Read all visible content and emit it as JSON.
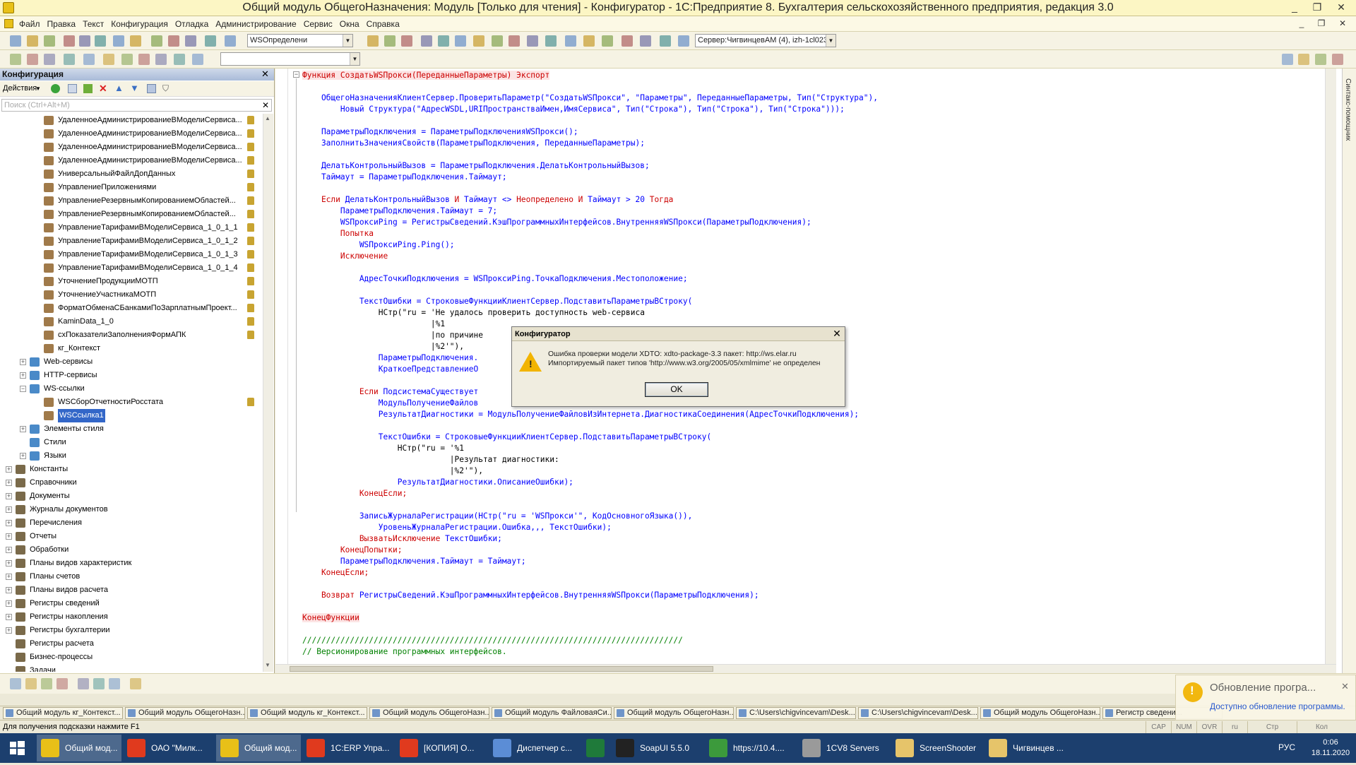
{
  "window": {
    "title": "Общий модуль ОбщегоНазначения: Модуль [Только для чтения] - Конфигуратор - 1С:Предприятие 8. Бухгалтерия сельскохозяйственного предприятия, редакция 3.0",
    "controls": [
      "_",
      "❐",
      "✕"
    ],
    "mdi_controls": [
      "_",
      "❐",
      "✕"
    ]
  },
  "menu": [
    "Файл",
    "Правка",
    "Текст",
    "Конфигурация",
    "Отладка",
    "Администрирование",
    "Сервис",
    "Окна",
    "Справка"
  ],
  "toolbar": {
    "search_value": "WSОпределени",
    "server_value": "Сервер:ЧигвинцевАМ (4), izh-1cl023"
  },
  "panel": {
    "title": "Конфигурация",
    "actions_label": "Действия",
    "search_placeholder": "Поиск (Ctrl+Alt+M)",
    "items": [
      {
        "label": "УдаленноеАдминистрированиеВМоделиСервиса...",
        "level": 3,
        "lock": true
      },
      {
        "label": "УдаленноеАдминистрированиеВМоделиСервиса...",
        "level": 3,
        "lock": true
      },
      {
        "label": "УдаленноеАдминистрированиеВМоделиСервиса...",
        "level": 3,
        "lock": true
      },
      {
        "label": "УдаленноеАдминистрированиеВМоделиСервиса...",
        "level": 3,
        "lock": true
      },
      {
        "label": "УниверсальныйФайлДопДанных",
        "level": 3,
        "lock": true
      },
      {
        "label": "УправлениеПриложениями",
        "level": 3,
        "lock": true
      },
      {
        "label": "УправлениеРезервнымКопированиемОбластей...",
        "level": 3,
        "lock": true
      },
      {
        "label": "УправлениеРезервнымКопированиемОбластей...",
        "level": 3,
        "lock": true
      },
      {
        "label": "УправлениеТарифамиВМоделиСервиса_1_0_1_1",
        "level": 3,
        "lock": true
      },
      {
        "label": "УправлениеТарифамиВМоделиСервиса_1_0_1_2",
        "level": 3,
        "lock": true
      },
      {
        "label": "УправлениеТарифамиВМоделиСервиса_1_0_1_3",
        "level": 3,
        "lock": true
      },
      {
        "label": "УправлениеТарифамиВМоделиСервиса_1_0_1_4",
        "level": 3,
        "lock": true
      },
      {
        "label": "УточнениеПродукцииМОТП",
        "level": 3,
        "lock": true
      },
      {
        "label": "УточнениеУчастникаМОТП",
        "level": 3,
        "lock": true
      },
      {
        "label": "ФорматОбменаСБанкамиПоЗарплатнымПроект...",
        "level": 3,
        "lock": true
      },
      {
        "label": "KaminData_1_0",
        "level": 3,
        "lock": true
      },
      {
        "label": "схПоказателиЗаполненияФормАПК",
        "level": 3,
        "lock": true
      },
      {
        "label": "кг_Контекст",
        "level": 3,
        "lock": false
      },
      {
        "label": "Web-сервисы",
        "level": 2,
        "expander": "+",
        "lock": false
      },
      {
        "label": "HTTP-сервисы",
        "level": 2,
        "expander": "+",
        "lock": false
      },
      {
        "label": "WS-ссылки",
        "level": 2,
        "expander": "−",
        "lock": false
      },
      {
        "label": "WSСборОтчетностиРосстата",
        "level": 3,
        "lock": true
      },
      {
        "label": "WSСсылка1",
        "level": 3,
        "lock": false,
        "selected": true
      },
      {
        "label": "Элементы стиля",
        "level": 2,
        "expander": "+",
        "lock": false
      },
      {
        "label": "Стили",
        "level": 2,
        "lock": false
      },
      {
        "label": "Языки",
        "level": 2,
        "expander": "+",
        "lock": false
      },
      {
        "label": "Константы",
        "level": 1,
        "expander": "+",
        "lock": false
      },
      {
        "label": "Справочники",
        "level": 1,
        "expander": "+",
        "lock": false
      },
      {
        "label": "Документы",
        "level": 1,
        "expander": "+",
        "lock": false
      },
      {
        "label": "Журналы документов",
        "level": 1,
        "expander": "+",
        "lock": false
      },
      {
        "label": "Перечисления",
        "level": 1,
        "expander": "+",
        "lock": false
      },
      {
        "label": "Отчеты",
        "level": 1,
        "expander": "+",
        "lock": false
      },
      {
        "label": "Обработки",
        "level": 1,
        "expander": "+",
        "lock": false
      },
      {
        "label": "Планы видов характеристик",
        "level": 1,
        "expander": "+",
        "lock": false
      },
      {
        "label": "Планы счетов",
        "level": 1,
        "expander": "+",
        "lock": false
      },
      {
        "label": "Планы видов расчета",
        "level": 1,
        "expander": "+",
        "lock": false
      },
      {
        "label": "Регистры сведений",
        "level": 1,
        "expander": "+",
        "lock": false
      },
      {
        "label": "Регистры накопления",
        "level": 1,
        "expander": "+",
        "lock": false
      },
      {
        "label": "Регистры бухгалтерии",
        "level": 1,
        "expander": "+",
        "lock": false
      },
      {
        "label": "Регистры расчета",
        "level": 1,
        "lock": false
      },
      {
        "label": "Бизнес-процессы",
        "level": 1,
        "lock": false
      },
      {
        "label": "Задачи",
        "level": 1,
        "lock": false
      }
    ]
  },
  "code": [
    [
      [
        "Функция СоздатьWSПрокси(ПереданныеПараметры) Экспорт",
        "#cc0000",
        "#fce4e4"
      ]
    ],
    [],
    [
      [
        "    ОбщегоНазначенияКлиентСервер.ПроверитьПараметр(\"СоздатьWSПрокси\", \"Параметры\", ПереданныеПараметры, Тип(\"Структура\"),",
        "#0000ff",
        ""
      ]
    ],
    [
      [
        "        Новый Структура(\"АдресWSDL,URIПространстваИмен,ИмяСервиса\", Тип(\"Строка\"), Тип(\"Строка\"), Тип(\"Строка\")));",
        "#0000ff",
        ""
      ]
    ],
    [],
    [
      [
        "    ПараметрыПодключения = ПараметрыПодключенияWSПрокси();",
        "#0000ff",
        ""
      ]
    ],
    [
      [
        "    ЗаполнитьЗначенияСвойств(ПараметрыПодключения, ПереданныеПараметры);",
        "#0000ff",
        ""
      ]
    ],
    [],
    [
      [
        "    ДелатьКонтрольныйВызов = ПараметрыПодключения.ДелатьКонтрольныйВызов;",
        "#0000ff",
        ""
      ]
    ],
    [
      [
        "    Таймаут = ПараметрыПодключения.Таймаут;",
        "#0000ff",
        ""
      ]
    ],
    [],
    [
      [
        "    Если ",
        "#cc0000",
        ""
      ],
      [
        "ДелатьКонтрольныйВызов ",
        "#0000ff",
        ""
      ],
      [
        "И ",
        "#cc0000",
        ""
      ],
      [
        "Таймаут <> ",
        "#0000ff",
        ""
      ],
      [
        "Неопределено И ",
        "#cc0000",
        ""
      ],
      [
        "Таймаут > 20 ",
        "#0000ff",
        ""
      ],
      [
        "Тогда",
        "#cc0000",
        ""
      ]
    ],
    [
      [
        "        ПараметрыПодключения.Таймаут = 7;",
        "#0000ff",
        ""
      ]
    ],
    [
      [
        "        WSПроксиPing = РегистрыСведений.КэшПрограммныхИнтерфейсов.ВнутренняяWSПрокси(ПараметрыПодключения);",
        "#0000ff",
        ""
      ]
    ],
    [
      [
        "        Попытка",
        "#cc0000",
        ""
      ]
    ],
    [
      [
        "            WSПроксиPing.Ping();",
        "#0000ff",
        ""
      ]
    ],
    [
      [
        "        Исключение",
        "#cc0000",
        ""
      ]
    ],
    [],
    [
      [
        "            АдресТочкиПодключения = WSПроксиPing.ТочкаПодключения.Местоположение;",
        "#0000ff",
        ""
      ]
    ],
    [],
    [
      [
        "            ТекстОшибки = СтроковыеФункцииКлиентСервер.ПодставитьПараметрыВСтроку(",
        "#0000ff",
        ""
      ]
    ],
    [
      [
        "                НСтр(\"ru = 'Не удалось проверить доступность web-сервиса",
        "#000000",
        ""
      ]
    ],
    [
      [
        "                           |%1",
        "#000000",
        ""
      ]
    ],
    [
      [
        "                           |по причине",
        "#000000",
        ""
      ]
    ],
    [
      [
        "                           |%2'\"),",
        "#000000",
        ""
      ]
    ],
    [
      [
        "                ПараметрыПодключения.",
        "#0000ff",
        ""
      ]
    ],
    [
      [
        "                КраткоеПредставлениеО",
        "#0000ff",
        ""
      ]
    ],
    [],
    [
      [
        "            Если ",
        "#cc0000",
        ""
      ],
      [
        "ПодсистемаСуществует",
        "#0000ff",
        ""
      ]
    ],
    [
      [
        "                МодульПолучениеФайлов",
        "#0000ff",
        ""
      ]
    ],
    [
      [
        "                РезультатДиагностики = МодульПолучениеФайловИзИнтернета.ДиагностикаСоединения(АдресТочкиПодключения);",
        "#0000ff",
        ""
      ]
    ],
    [],
    [
      [
        "                ТекстОшибки = СтроковыеФункцииКлиентСервер.ПодставитьПараметрыВСтроку(",
        "#0000ff",
        ""
      ]
    ],
    [
      [
        "                    НСтр(\"ru = '%1",
        "#000000",
        ""
      ]
    ],
    [
      [
        "                               |Результат диагностики:",
        "#000000",
        ""
      ]
    ],
    [
      [
        "                               |%2'\"),",
        "#000000",
        ""
      ]
    ],
    [
      [
        "                    РезультатДиагностики.ОписаниеОшибки);",
        "#0000ff",
        ""
      ]
    ],
    [
      [
        "            КонецЕсли;",
        "#cc0000",
        ""
      ]
    ],
    [],
    [
      [
        "            ЗаписьЖурналаРегистрации(НСтр(\"ru = 'WSПрокси'\", КодОсновногоЯзыка()),",
        "#0000ff",
        ""
      ]
    ],
    [
      [
        "                УровеньЖурналаРегистрации.Ошибка,,, ТекстОшибки);",
        "#0000ff",
        ""
      ]
    ],
    [
      [
        "            ВызватьИсключение ",
        "#cc0000",
        ""
      ],
      [
        "ТекстОшибки;",
        "#0000ff",
        ""
      ]
    ],
    [
      [
        "        КонецПопытки;",
        "#cc0000",
        ""
      ]
    ],
    [
      [
        "        ПараметрыПодключения.Таймаут = Таймаут;",
        "#0000ff",
        ""
      ]
    ],
    [
      [
        "    КонецЕсли;",
        "#cc0000",
        ""
      ]
    ],
    [],
    [
      [
        "    Возврат ",
        "#cc0000",
        ""
      ],
      [
        "РегистрыСведений.КэшПрограммныхИнтерфейсов.ВнутренняяWSПрокси(ПараметрыПодключения);",
        "#0000ff",
        ""
      ]
    ],
    [],
    [
      [
        "КонецФункции",
        "#cc0000",
        "#fce4e4"
      ]
    ],
    [],
    [
      [
        "////////////////////////////////////////////////////////////////////////////////",
        "#008000",
        ""
      ]
    ],
    [
      [
        "// Версионирование программных интерфейсов.",
        "#008000",
        ""
      ]
    ]
  ],
  "dialog": {
    "title": "Конфигуратор",
    "line1": "Ошибка проверки модели XDTO: xdto-package-3.3    пакет: http://ws.elar.ru",
    "line2": "Импортируемый пакет типов 'http://www.w3.org/2005/05/xmlmime' не определен",
    "ok": "OK"
  },
  "right_panel": "Синтакс-помощник",
  "doc_tabs": [
    "Общий модуль кг_Контекст...",
    "Общий модуль ОбщегоНазн...",
    "Общий модуль кг_Контекст...",
    "Общий модуль ОбщегоНазн...",
    "Общий модуль ФайловаяСи...",
    "Общий модуль ОбщегоНазн...",
    "C:\\Users\\chigvincevam\\Desk...",
    "C:\\Users\\chigvincevam\\Desk...",
    "Общий модуль ОбщегоНазн...",
    "Регистр сведени..."
  ],
  "status": {
    "hint": "Для получения подсказки нажмите F1",
    "cap": "CAP",
    "num": "NUM",
    "ovr": "OVR",
    "lang": "ru",
    "str": "Стр",
    "kol": "Кол"
  },
  "toast": {
    "title": "Обновление програ...",
    "link": "Доступно обновление программы."
  },
  "taskbar": {
    "items": [
      {
        "label": "Общий мод...",
        "color": "#e8c018",
        "active": true
      },
      {
        "label": "ОАО \"Милк...",
        "color": "#e03a1e",
        "active": false
      },
      {
        "label": "Общий мод...",
        "color": "#e8c018",
        "active": true
      },
      {
        "label": "1С:ERP Упра...",
        "color": "#e03a1e",
        "active": false
      },
      {
        "label": "[КОПИЯ] О...",
        "color": "#e03a1e",
        "active": false
      },
      {
        "label": "Диспетчер с...",
        "color": "#5b8dd6",
        "active": false
      },
      {
        "label": "",
        "color": "#1f7a3a",
        "active": false
      },
      {
        "label": "SoapUI 5.5.0",
        "color": "#222222",
        "active": false
      },
      {
        "label": "https://10.4....",
        "color": "#3c9a3c",
        "active": false
      },
      {
        "label": "1CV8 Servers",
        "color": "#9a9a9a",
        "active": false
      },
      {
        "label": "ScreenShooter",
        "color": "#e6c46a",
        "active": false
      },
      {
        "label": "Чигвинцев ...",
        "color": "#e6c46a",
        "active": false
      }
    ],
    "lang": "РУС",
    "time": "0:06",
    "date": "18.11.2020"
  }
}
